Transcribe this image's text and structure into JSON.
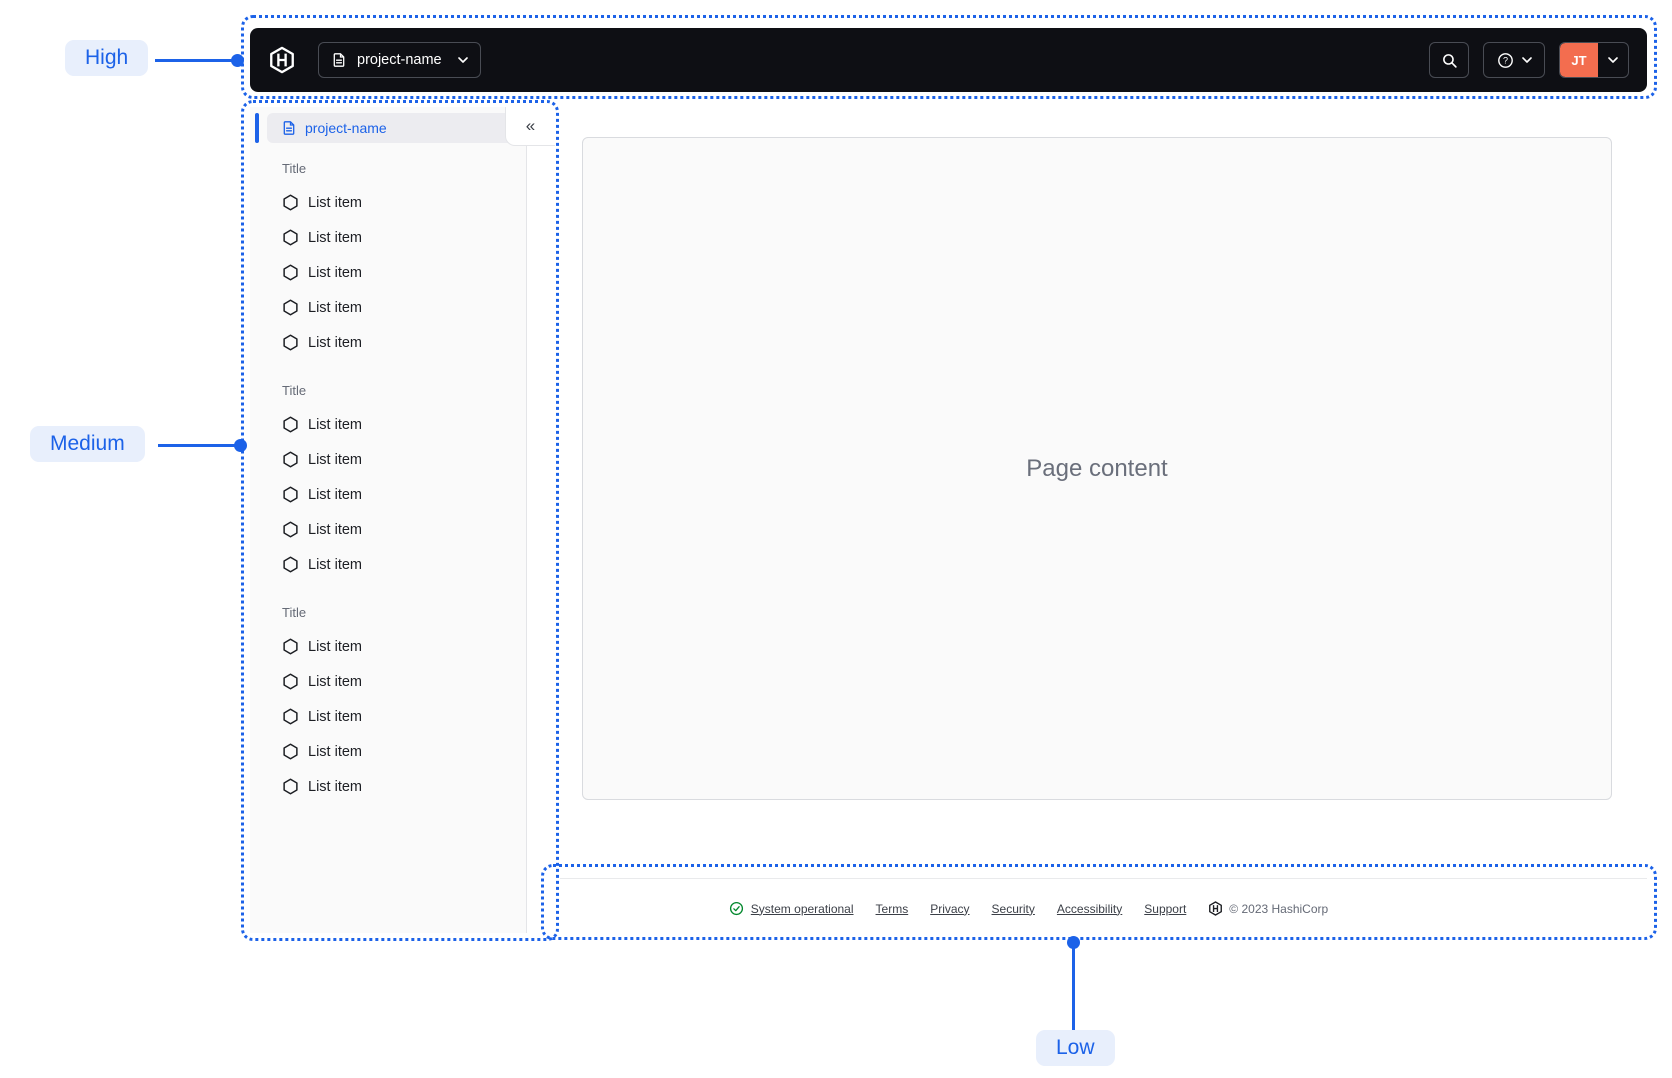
{
  "annotations": {
    "accent_color": "#1c62e8",
    "high": "High",
    "medium": "Medium",
    "low": "Low"
  },
  "navbar": {
    "background_color": "#0e0f14",
    "logo_icon": "hashicorp-logo",
    "project_switcher": "project-name",
    "avatar_initials": "JT",
    "avatar_color": "#f36d4f"
  },
  "sidebar": {
    "active_item": "project-name",
    "collapse_glyph": "«",
    "sections": [
      {
        "title": "Title",
        "items": [
          "List item",
          "List item",
          "List item",
          "List item",
          "List item"
        ]
      },
      {
        "title": "Title",
        "items": [
          "List item",
          "List item",
          "List item",
          "List item",
          "List item"
        ]
      },
      {
        "title": "Title",
        "items": [
          "List item",
          "List item",
          "List item",
          "List item",
          "List item"
        ]
      }
    ]
  },
  "main": {
    "placeholder": "Page content"
  },
  "footer": {
    "status": "System operational",
    "status_color": "#00872b",
    "links": [
      "Terms",
      "Privacy",
      "Security",
      "Accessibility",
      "Support"
    ],
    "copyright": "© 2023 HashiCorp"
  }
}
